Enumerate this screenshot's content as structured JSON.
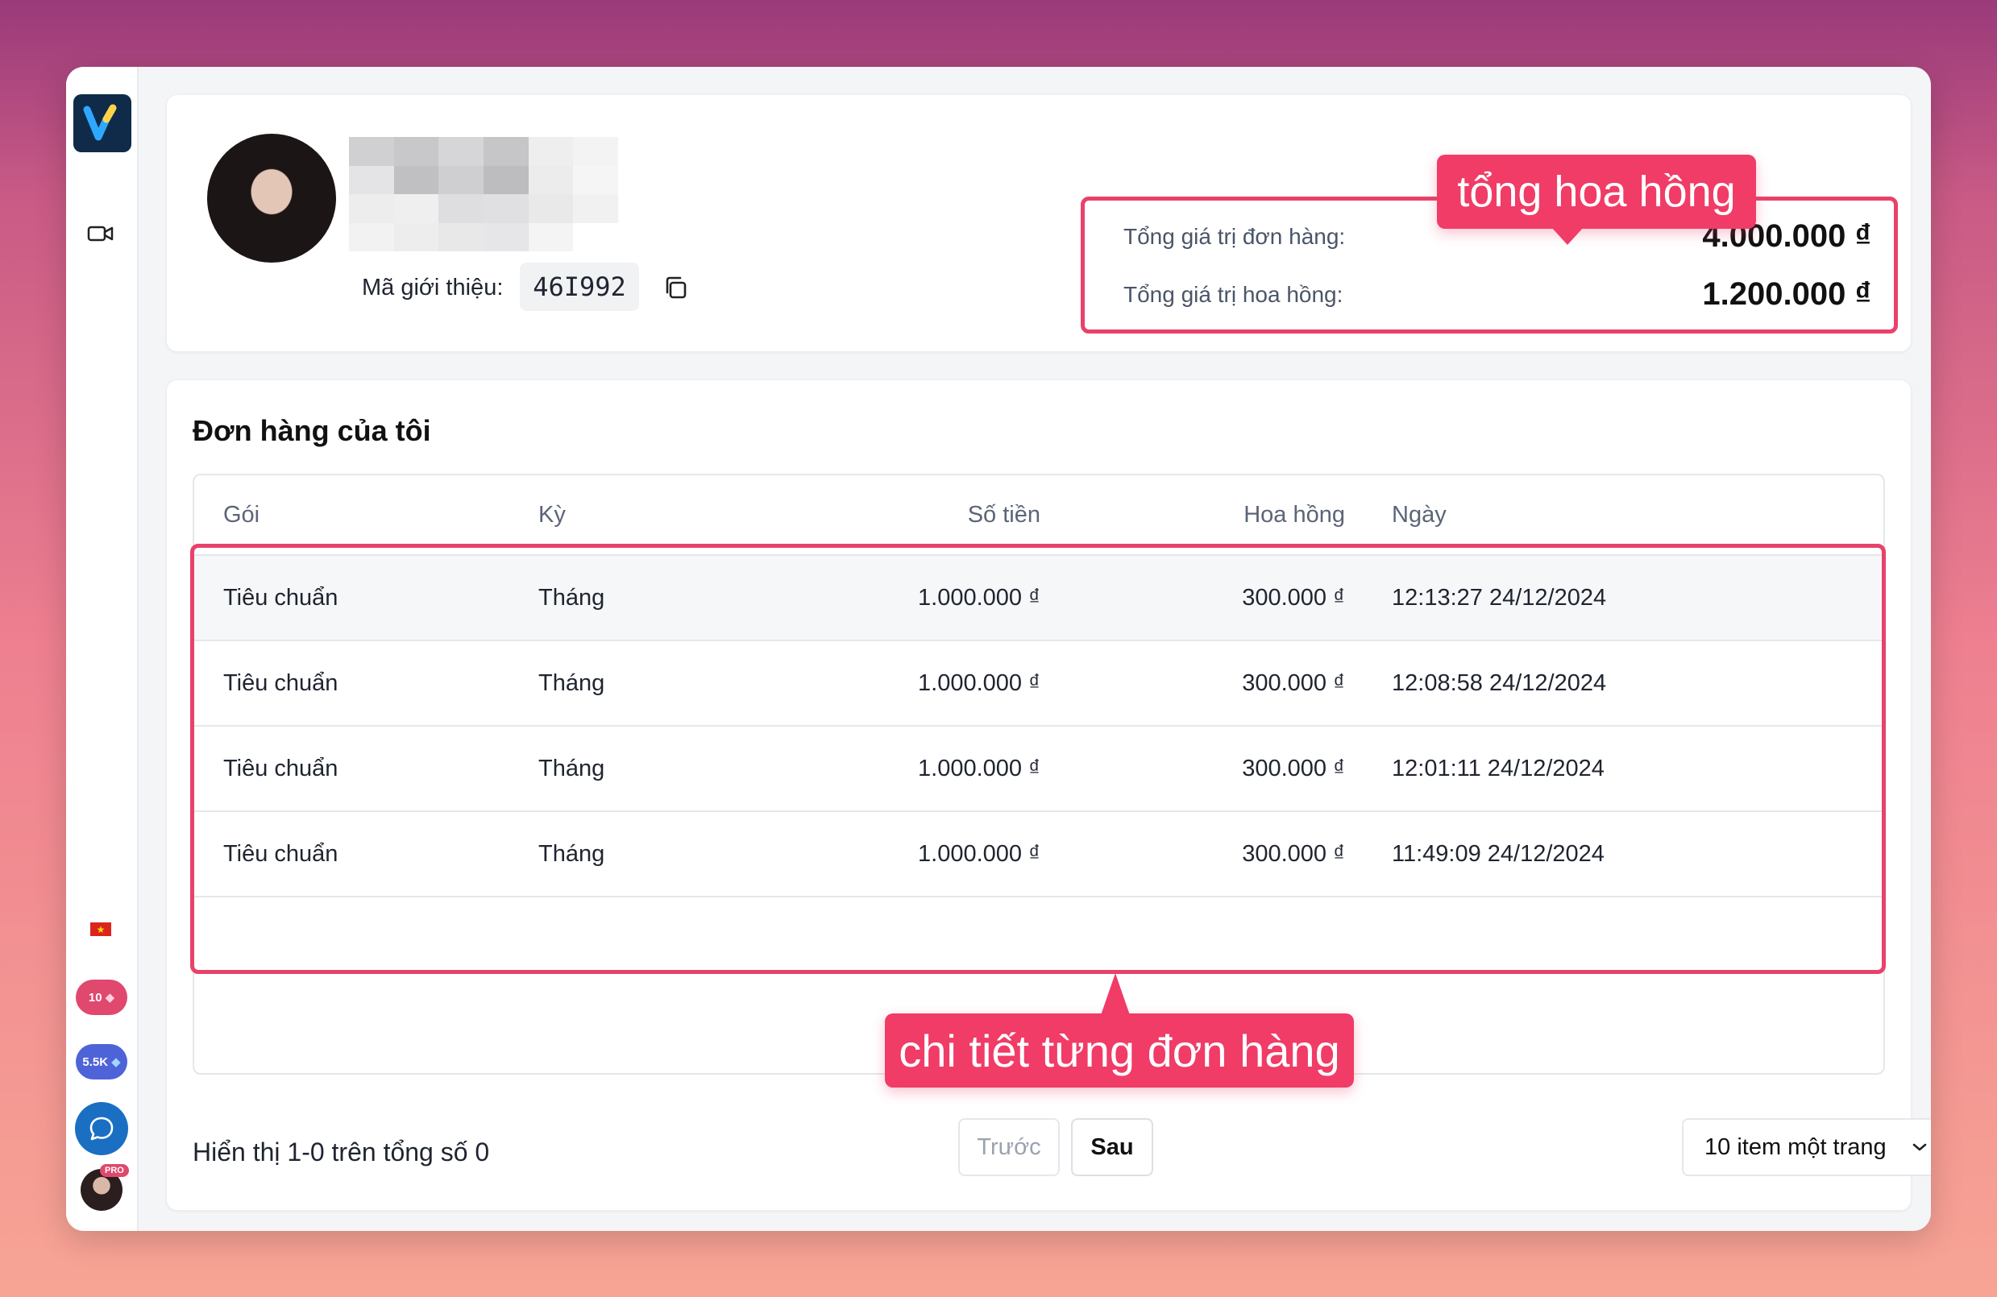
{
  "profile": {
    "referral_label": "Mã giới thiệu:",
    "referral_code": "46I992"
  },
  "summary": {
    "order_total_label": "Tổng giá trị đơn hàng:",
    "order_total_value": "4.000.000 ₫",
    "commission_total_label": "Tổng giá trị hoa hồng:",
    "commission_total_value": "1.200.000 ₫"
  },
  "callouts": {
    "top": "tổng hoa hồng",
    "bottom": "chi tiết từng đơn hàng"
  },
  "orders": {
    "title": "Đơn hàng của tôi",
    "columns": [
      "Gói",
      "Kỳ",
      "Số tiền",
      "Hoa hồng",
      "Ngày"
    ],
    "rows": [
      [
        "Tiêu chuẩn",
        "Tháng",
        "1.000.000 ₫",
        "300.000 ₫",
        "12:13:27 24/12/2024"
      ],
      [
        "Tiêu chuẩn",
        "Tháng",
        "1.000.000 ₫",
        "300.000 ₫",
        "12:08:58 24/12/2024"
      ],
      [
        "Tiêu chuẩn",
        "Tháng",
        "1.000.000 ₫",
        "300.000 ₫",
        "12:01:11 24/12/2024"
      ],
      [
        "Tiêu chuẩn",
        "Tháng",
        "1.000.000 ₫",
        "300.000 ₫",
        "11:49:09 24/12/2024"
      ]
    ]
  },
  "footer": {
    "showing_text": "Hiển thị 1-0 trên tổng số 0",
    "prev_label": "Trước",
    "next_label": "Sau",
    "per_page": "10 item một trang"
  },
  "sidebar": {
    "badge_credits": "10",
    "badge_gems": "5.5K",
    "pro_label": "PRO"
  },
  "colors": {
    "accent": "#f03c67",
    "highlight_border": "#e8426a",
    "logo_bg": "#0f2b49"
  }
}
